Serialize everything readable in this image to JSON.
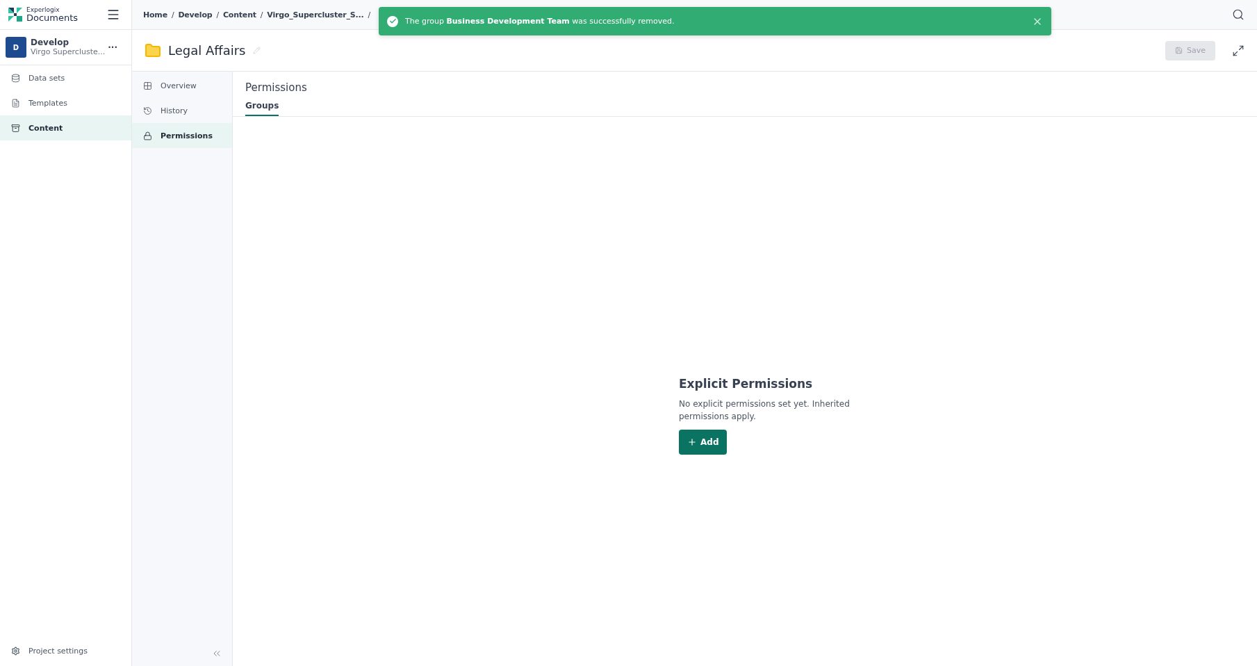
{
  "brand": {
    "top": "Experlogix",
    "name": "Documents"
  },
  "project": {
    "initial": "D",
    "name": "Develop",
    "subtitle": "Virgo Supercluste...",
    "more": "···"
  },
  "sidebar": {
    "items": [
      {
        "label": "Data sets",
        "selected": false
      },
      {
        "label": "Templates",
        "selected": false
      },
      {
        "label": "Content",
        "selected": true
      }
    ],
    "footer": {
      "label": "Project settings"
    }
  },
  "breadcrumb": {
    "items": [
      "Home",
      "Develop",
      "Content",
      "Virgo_Supercluster_S..."
    ],
    "separators": [
      "/",
      "/",
      "/",
      "/"
    ]
  },
  "toast": {
    "message": "The group **Business Development Team** was successfully removed."
  },
  "page": {
    "title": "Legal Affairs",
    "save": {
      "label": "Save",
      "disabled": true
    }
  },
  "subnav": [
    {
      "label": "Overview",
      "selected": false
    },
    {
      "label": "History",
      "selected": false
    },
    {
      "label": "Permissions",
      "selected": true
    }
  ],
  "section": {
    "title": "Permissions",
    "tabs": [
      {
        "label": "Groups",
        "selected": true
      }
    ]
  },
  "empty": {
    "title": "Explicit Permissions",
    "text": "No explicit permissions set yet. Inherited permissions apply.",
    "button": "Add"
  }
}
